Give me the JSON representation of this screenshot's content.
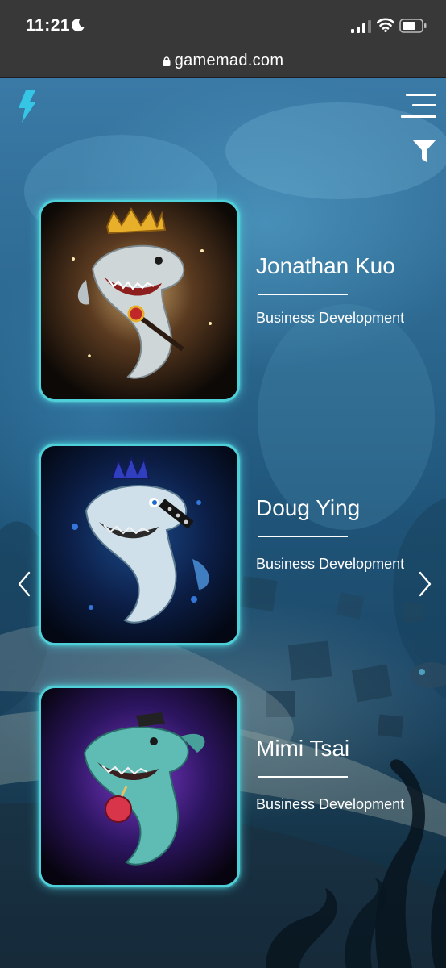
{
  "status_bar": {
    "time": "11:21",
    "icons": [
      "moon-icon",
      "cellular-signal-icon",
      "wifi-icon",
      "battery-icon"
    ]
  },
  "browser": {
    "url": "gamemad.com"
  },
  "header": {
    "logo_icon": "lightning-bolt-icon",
    "menu_icon": "hamburger-menu-icon",
    "filter_icon": "filter-funnel-icon"
  },
  "colors": {
    "accent": "#35c6e6",
    "card_border": "#4fd0d8",
    "text": "#ffffff",
    "status_bar": "#383838"
  },
  "team": [
    {
      "name": "Jonathan Kuo",
      "role": "Business Development",
      "avatar": "crowned-golden-shark"
    },
    {
      "name": "Doug Ying",
      "role": "Business Development",
      "avatar": "punk-mohawk-shark"
    },
    {
      "name": "Mimi Tsai",
      "role": "Business Development",
      "avatar": "pirate-shark-with-bomb"
    }
  ],
  "carousel": {
    "prev_icon": "chevron-left-icon",
    "next_icon": "chevron-right-icon"
  }
}
